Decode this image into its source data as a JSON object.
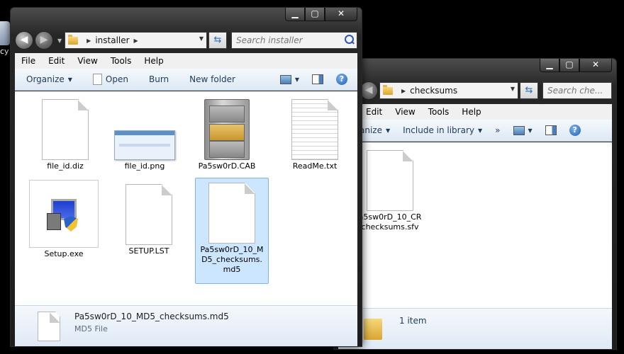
{
  "desktop": {
    "partial_label": "cy"
  },
  "win2": {
    "breadcrumb": "checksums",
    "search_placeholder": "Search che...",
    "menu": [
      "Edit",
      "View",
      "Tools",
      "Help"
    ],
    "cmd_organize": "anize",
    "cmd_include": "Include in library",
    "cmd_more": "»",
    "file_label": "a5sw0rD_10_CR checksums.sfv",
    "status": "1 item"
  },
  "win1": {
    "breadcrumb": "installer",
    "search_placeholder": "Search installer",
    "menu": [
      "File",
      "Edit",
      "View",
      "Tools",
      "Help"
    ],
    "commands": {
      "organize": "Organize",
      "open": "Open",
      "burn": "Burn",
      "new_folder": "New folder"
    },
    "files": [
      {
        "name": "file_id.diz"
      },
      {
        "name": "file_id.png"
      },
      {
        "name": "Pa5sw0rD.CAB"
      },
      {
        "name": "ReadMe.txt"
      },
      {
        "name": "Setup.exe"
      },
      {
        "name": "SETUP.LST"
      },
      {
        "name": "Pa5sw0rD_10_MD5_checksums.md5"
      }
    ],
    "details": {
      "name": "Pa5sw0rD_10_MD5_checksums.md5",
      "type": "MD5 File"
    }
  },
  "colors": {
    "selection": "#cce6ff",
    "selection_border": "#7eb4ea",
    "command_text": "#1e395b"
  }
}
